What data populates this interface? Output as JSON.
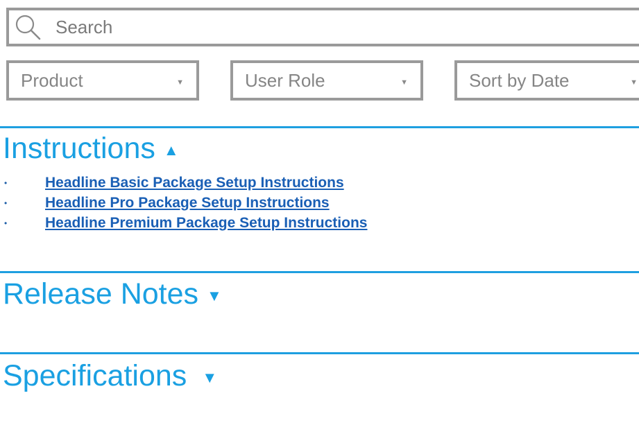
{
  "search": {
    "placeholder": "Search",
    "icon": "search-icon"
  },
  "filters": {
    "product": {
      "label": "Product",
      "icon": "chevron-down-icon"
    },
    "user_role": {
      "label": "User Role",
      "icon": "chevron-down-icon"
    },
    "sort": {
      "label": "Sort by Date",
      "icon": "chevron-down-icon"
    }
  },
  "sections": {
    "instructions": {
      "title": "Instructions",
      "toggle": "▲",
      "links": [
        "Headline Basic Package Setup Instructions",
        "Headline Pro Package Setup Instructions",
        "Headline Premium Package Setup Instructions"
      ]
    },
    "release_notes": {
      "title": "Release Notes",
      "toggle": "▼"
    },
    "specifications": {
      "title": "Specifications",
      "toggle": "▼"
    }
  },
  "colors": {
    "accent": "#1aa0e2",
    "link": "#1a5fb5",
    "border": "#9a9a9a",
    "placeholder_text": "#7a7a7a"
  }
}
